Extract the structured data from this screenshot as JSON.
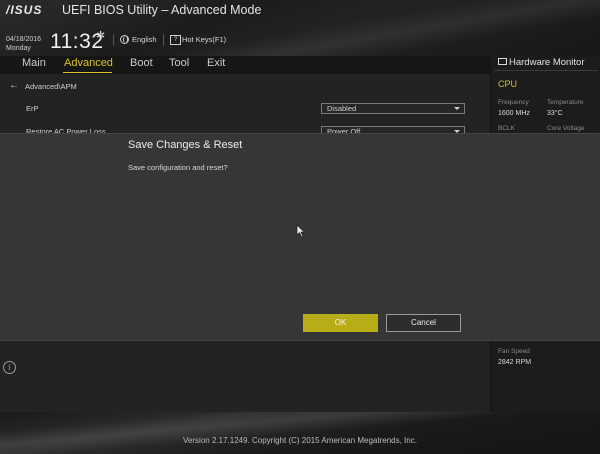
{
  "header": {
    "logo": "/ISUS",
    "title": "UEFI BIOS Utility – Advanced Mode",
    "date": "04/18/2016",
    "weekday": "Monday",
    "time": "11:32",
    "language": "English",
    "hotkeys": "Hot Keys(F1)",
    "hotkey_glyph": "?"
  },
  "menu": {
    "items": [
      "Main",
      "Advanced",
      "Boot",
      "Tool",
      "Exit"
    ],
    "active": "Advanced"
  },
  "main": {
    "breadcrumb": "Advanced\\APM",
    "settings": [
      {
        "label": "ErP",
        "value": "Disabled"
      },
      {
        "label": "Restore AC Power Loss",
        "value": "Power Off"
      }
    ]
  },
  "hardware_monitor": {
    "title": "Hardware Monitor",
    "cpu_heading": "CPU",
    "frequency_label": "Frequency",
    "frequency_value": "1600 MHz",
    "temperature_label": "Temperature",
    "temperature_value": "33°C",
    "bclk_label": "BCLK",
    "core_voltage_label": "Core Voltage",
    "fan_speed_label": "Fan Speed",
    "fan_speed_value": "2842 RPM"
  },
  "dialog": {
    "title": "Save Changes & Reset",
    "message": "Save configuration and reset?",
    "ok_label": "OK",
    "cancel_label": "Cancel"
  },
  "footer": {
    "version": "Version 2.17.1249. Copyright (C) 2015 American Megatrends, Inc."
  },
  "colors": {
    "accent": "#d6c22a",
    "ok_button": "#b9ad17",
    "background": "#141414"
  },
  "icons": [
    "gear-icon",
    "globe-icon",
    "hotkey-icon",
    "back-arrow-icon",
    "monitor-icon",
    "info-icon",
    "mouse-cursor-icon"
  ]
}
